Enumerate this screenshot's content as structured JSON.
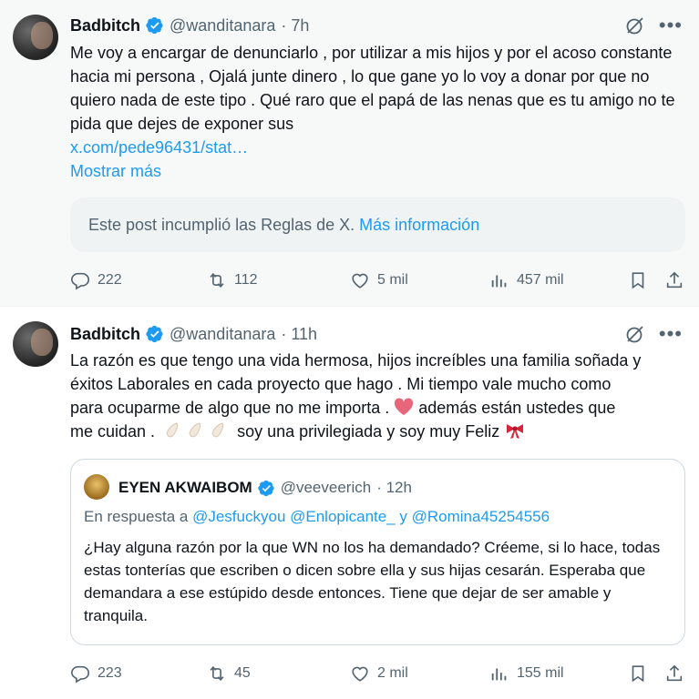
{
  "colors": {
    "accent": "#1d9bf0",
    "muted": "#536471",
    "text": "#0f1419"
  },
  "tweet1": {
    "name": "Badbitch",
    "handle": "@wanditanara",
    "time": "· 7h",
    "text": "Me voy a encargar de denunciarlo , por utilizar a mis hijos y por el acoso constante hacia mi persona , Ojalá junte dinero , lo que gane yo lo voy a donar  por que no quiero nada de este tipo . Qué raro que el papá de las nenas que es tu amigo no te pida que dejes de exponer sus",
    "link": "x.com/pede96431/stat…",
    "show_more": "Mostrar más",
    "notice_text": "Este post incumplió las Reglas de X.",
    "notice_link": "Más información",
    "replies": "222",
    "reposts": "112",
    "likes": "5 mil",
    "views": "457 mil"
  },
  "tweet2": {
    "name": "Badbitch",
    "handle": "@wanditanara",
    "time": "· 11h",
    "text_line1": "La razón es que tengo una vida hermosa, hijos increíbles una familia soñada y",
    "text_line2": "éxitos Laborales en cada proyecto que hago . Mi tiempo vale mucho como",
    "text_line3a": "para ocuparme de algo que no me importa .",
    "text_line3b": "además están ustedes que",
    "text_line4a": "me cuidan .",
    "text_line4b": "soy una privilegiada y soy muy Feliz",
    "quote": {
      "name": "EYEN AKWAIBOM",
      "handle": "@veeveerich",
      "time": "· 12h",
      "reply_prefix": "En respuesta a",
      "reply_to": "@Jesfuckyou @Enlopicante_ y @Romina45254556",
      "text": "¿Hay alguna razón por la que WN no los ha demandado? Créeme, si lo hace, todas estas tonterías que escriben o dicen sobre ella y sus hijas cesarán. Esperaba que demandara a ese estúpido desde entonces. Tiene que dejar de ser amable y tranquila."
    },
    "replies": "223",
    "reposts": "45",
    "likes": "2 mil",
    "views": "155 mil"
  },
  "icons": [
    "verified-badge-icon",
    "grok-icon",
    "more-icon",
    "reply-icon",
    "repost-icon",
    "like-icon",
    "views-icon",
    "bookmark-icon",
    "share-icon",
    "heart-emoji-icon",
    "clap-emoji-icon",
    "ribbon-emoji-icon"
  ]
}
